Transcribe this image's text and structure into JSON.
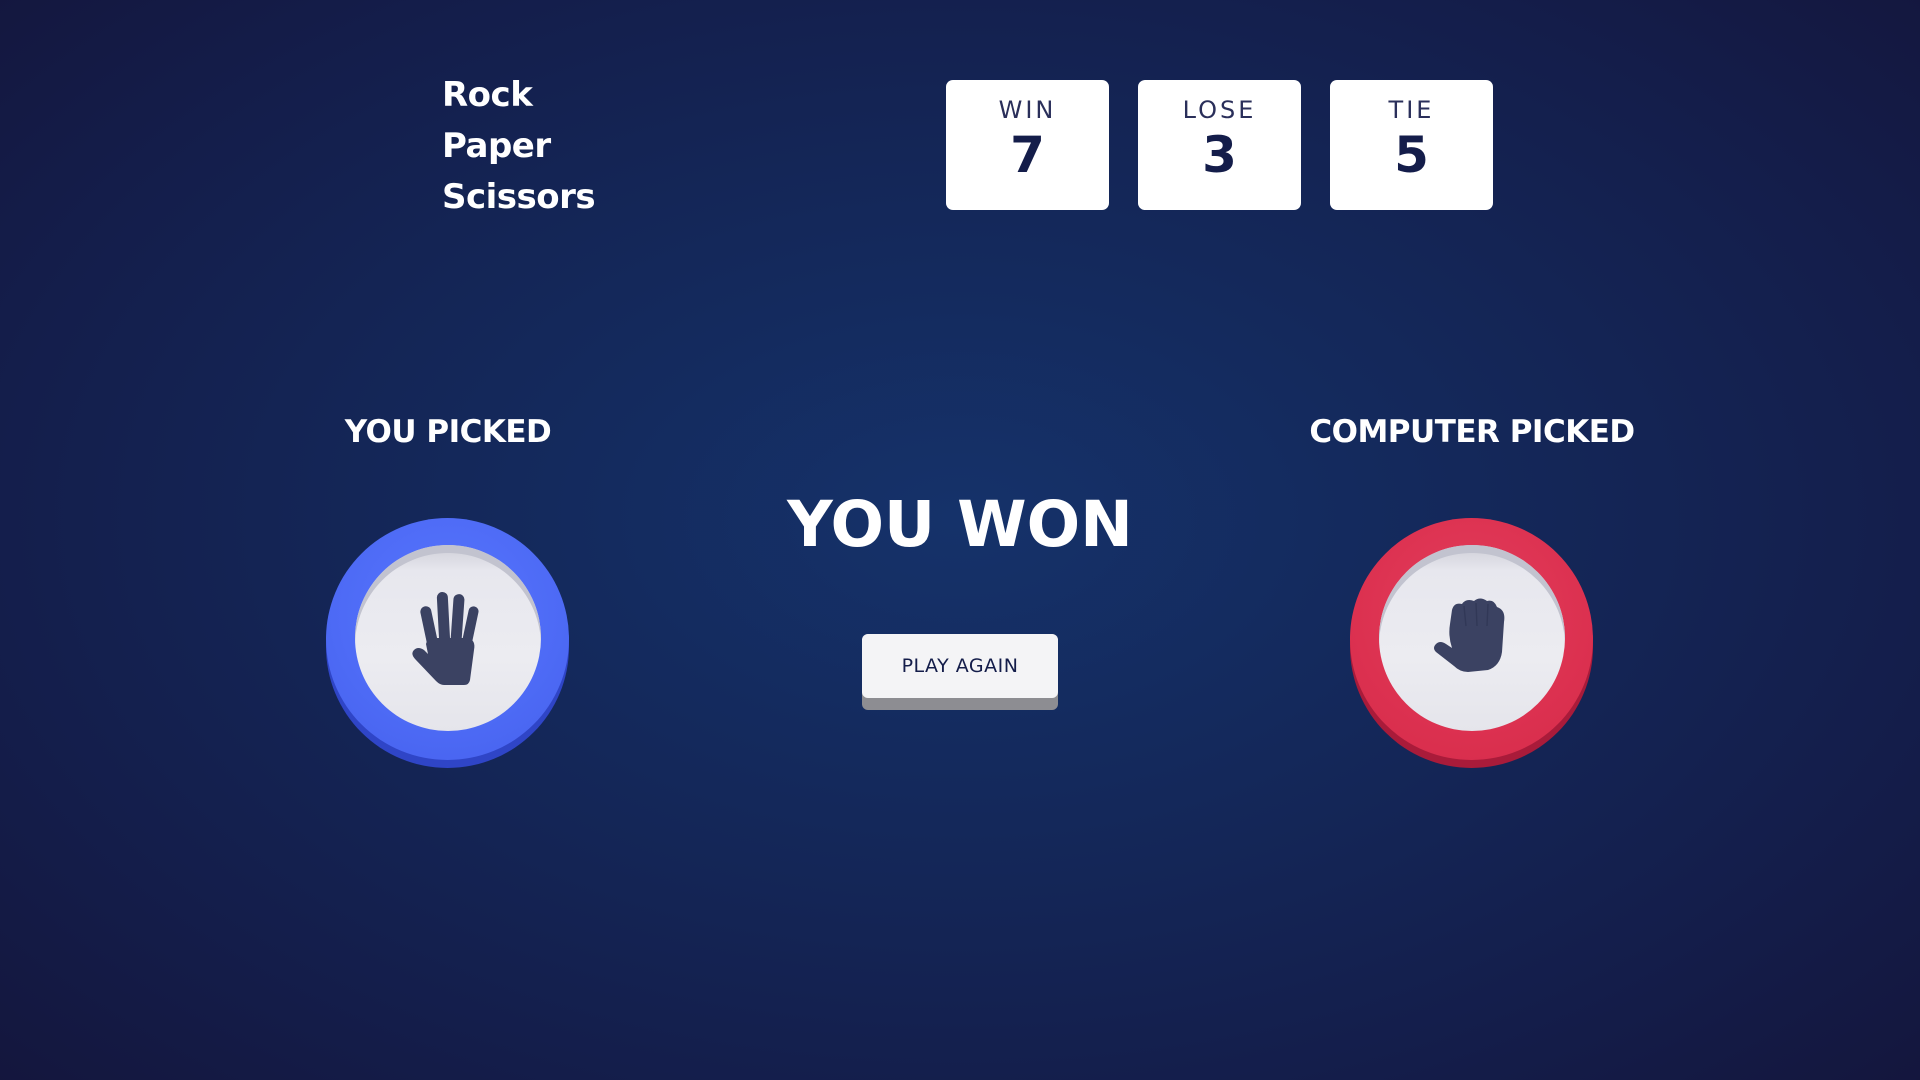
{
  "app": {
    "title_lines": [
      "Rock",
      "Paper",
      "Scissors"
    ]
  },
  "scores": [
    {
      "label": "WIN",
      "value": "7"
    },
    {
      "label": "LOSE",
      "value": "3"
    },
    {
      "label": "TIE",
      "value": "5"
    }
  ],
  "player": {
    "label": "YOU PICKED",
    "choice": "paper",
    "icon": "paper-hand-icon",
    "color": "#4d6af5"
  },
  "computer": {
    "label": "COMPUTER PICKED",
    "choice": "rock",
    "icon": "rock-fist-icon",
    "color": "#dc3150"
  },
  "result": {
    "text": "YOU WON",
    "button_label": "PLAY AGAIN"
  }
}
